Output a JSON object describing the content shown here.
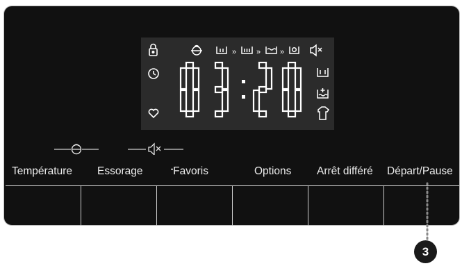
{
  "display": {
    "time": "03:20",
    "icons_left": [
      "lock-icon",
      "clock-icon",
      "heart-icon"
    ],
    "icons_top": [
      "child-face-icon",
      "prewash-basin-icon",
      "wash-basin-icon",
      "rinse-basin-icon",
      "spin-icon",
      "mute-speaker-icon"
    ],
    "icons_right": [
      "basin-icon",
      "extra-rinse-icon",
      "shirt-icon"
    ],
    "separator_glyph": "»"
  },
  "caption_icons": [
    "child-lock-icon",
    "mute-icon"
  ],
  "buttons": [
    {
      "label": "Température"
    },
    {
      "label": "Essorage"
    },
    {
      "label": "Favoris",
      "prefix": "•"
    },
    {
      "label": "Options"
    },
    {
      "label": "Arrêt différé"
    },
    {
      "label": "Départ/Pause"
    }
  ],
  "callout": {
    "number": "3"
  },
  "colors": {
    "panel": "#111111",
    "display": "#2b2b2b",
    "segment": "#ffffff",
    "badge": "#1a1a1a"
  }
}
